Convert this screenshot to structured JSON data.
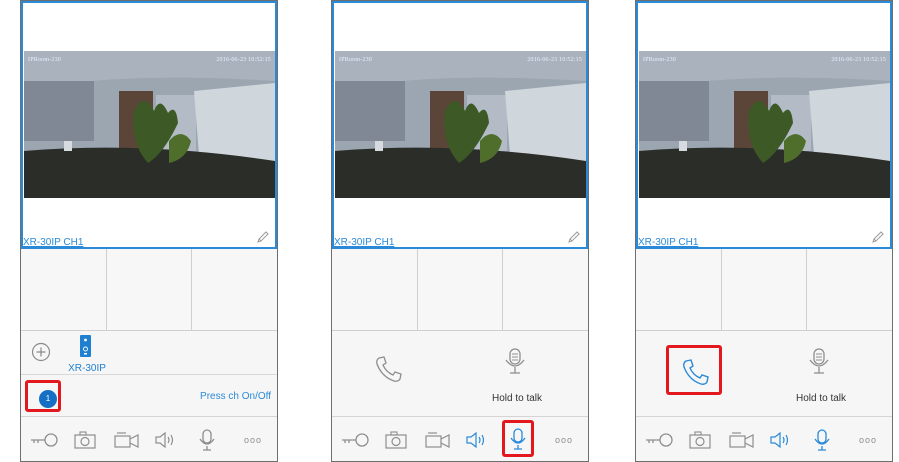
{
  "camera_label": "XR-30IP CH1",
  "osd": {
    "left": "IPRoom-230",
    "right": "2016-06-23 10:52:15"
  },
  "device": {
    "name": "XR-30IP"
  },
  "channel": {
    "number": "1",
    "hint": "Press ch On/Off"
  },
  "talk": {
    "hold_label": "Hold to talk"
  },
  "toolbar": {
    "more_label": "ooo"
  },
  "colors": {
    "accent": "#2a8ad8",
    "highlight": "#e3181f",
    "channel_dot": "#1570c5",
    "border": "#6e6e6e"
  },
  "icons": [
    "plus-icon",
    "intercom-device-icon",
    "edit-icon",
    "key-icon",
    "camera-icon",
    "record-icon",
    "speaker-icon",
    "microphone-icon",
    "more-icon",
    "hangup-icon"
  ]
}
